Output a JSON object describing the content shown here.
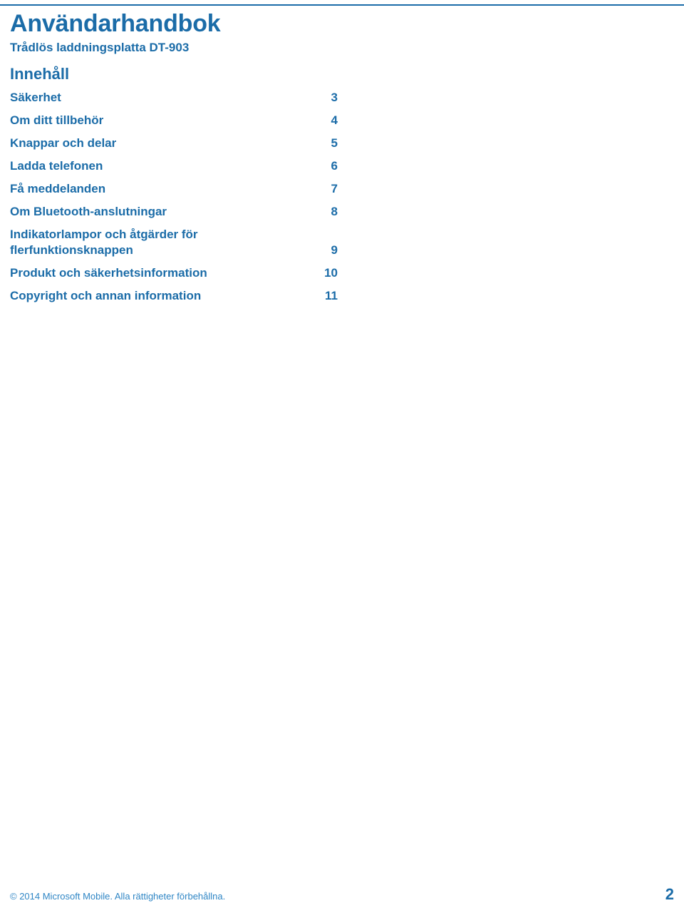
{
  "document": {
    "title": "Användarhandbok",
    "subtitle": "Trådlös laddningsplatta DT-903",
    "toc_heading": "Innehåll"
  },
  "toc": {
    "entries": [
      {
        "label": "Säkerhet",
        "page": "3"
      },
      {
        "label": "Om ditt tillbehör",
        "page": "4"
      },
      {
        "label": "Knappar och delar",
        "page": "5"
      },
      {
        "label": "Ladda telefonen",
        "page": "6"
      },
      {
        "label": "Få meddelanden",
        "page": "7"
      },
      {
        "label": "Om Bluetooth-anslutningar",
        "page": "8"
      },
      {
        "label": "Indikatorlampor och åtgärder för flerfunktionsknappen",
        "page": "9"
      },
      {
        "label": "Produkt och säkerhetsinformation",
        "page": "10"
      },
      {
        "label": "Copyright och annan information",
        "page": "11"
      }
    ]
  },
  "footer": {
    "copyright": "© 2014 Microsoft Mobile. Alla rättigheter förbehållna.",
    "page_number": "2"
  },
  "colors": {
    "accent": "#1b6ca8",
    "footer_text": "#2f86c5"
  }
}
